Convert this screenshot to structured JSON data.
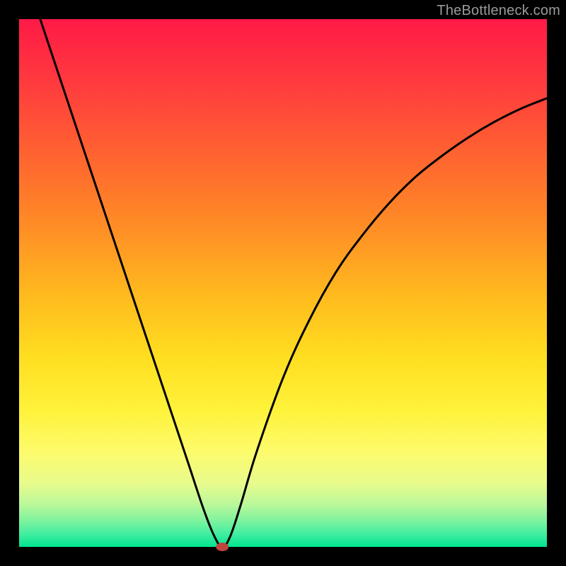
{
  "watermark": "TheBottleneck.com",
  "chart_data": {
    "type": "line",
    "title": "",
    "xlabel": "",
    "ylabel": "",
    "xlim": [
      0,
      100
    ],
    "ylim": [
      0,
      100
    ],
    "grid": false,
    "legend": false,
    "series": [
      {
        "name": "curve",
        "x": [
          4,
          8,
          12,
          16,
          20,
          24,
          28,
          32,
          35,
          37,
          38.5,
          40,
          42,
          45,
          50,
          55,
          60,
          65,
          70,
          75,
          80,
          85,
          90,
          95,
          100
        ],
        "y": [
          100,
          88,
          76,
          64,
          52,
          40,
          28,
          16,
          7,
          2,
          0,
          2,
          8,
          18,
          32,
          43,
          52,
          59,
          65,
          70,
          74,
          77.5,
          80.5,
          83,
          85
        ]
      }
    ],
    "marker": {
      "x": 38.5,
      "y": 0,
      "rx": 1.2,
      "ry": 0.8
    },
    "background_gradient": {
      "top": "#ff1a46",
      "bottom": "#00e38f"
    }
  }
}
